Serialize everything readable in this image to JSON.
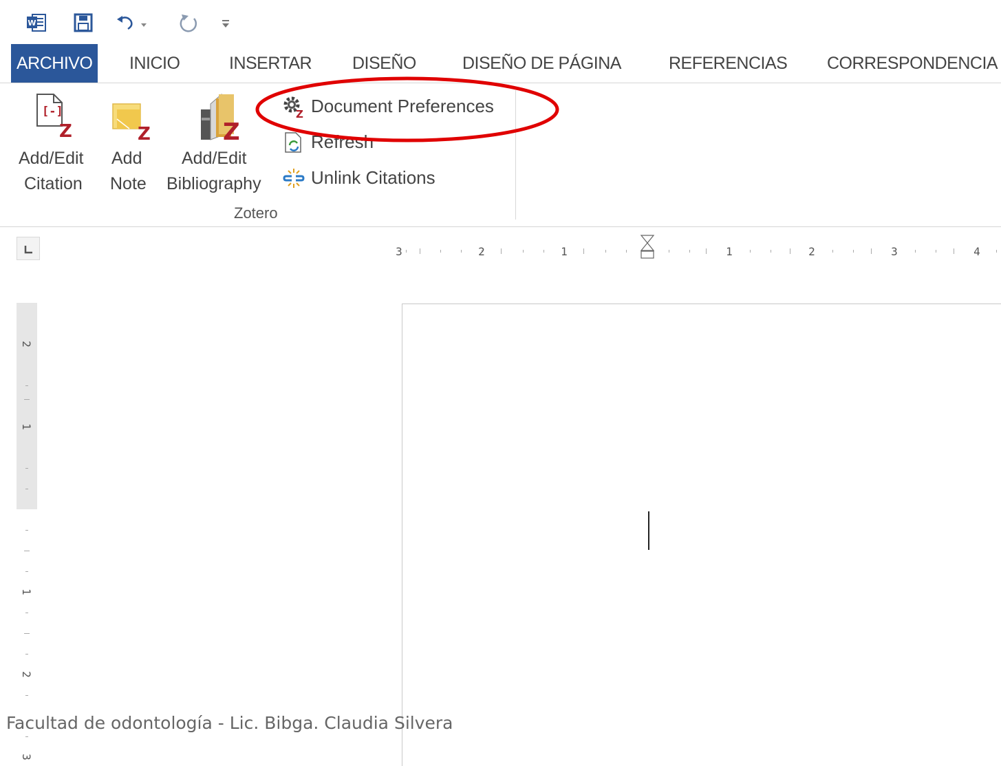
{
  "quick_access": {
    "icons": [
      "word-icon",
      "save-icon",
      "undo-icon",
      "redo-icon",
      "customize-toolbar-icon"
    ]
  },
  "tabs": [
    {
      "label": "ARCHIVO",
      "active": true
    },
    {
      "label": "INICIO"
    },
    {
      "label": "INSERTAR"
    },
    {
      "label": "DISEÑO"
    },
    {
      "label": "DISEÑO DE PÁGINA"
    },
    {
      "label": "REFERENCIAS"
    },
    {
      "label": "CORRESPONDENCIA"
    }
  ],
  "ribbon": {
    "add_edit_citation": {
      "line1": "Add/Edit",
      "line2": "Citation"
    },
    "add_note": {
      "line1": "Add",
      "line2": "Note"
    },
    "add_edit_bibliography": {
      "line1": "Add/Edit",
      "line2": "Bibliography"
    },
    "document_preferences": "Document Preferences",
    "refresh": "Refresh",
    "unlink_citations": "Unlink Citations",
    "group_label": "Zotero"
  },
  "ruler": {
    "horizontal_labels": [
      "3",
      "2",
      "1",
      "1",
      "2",
      "3",
      "4"
    ],
    "vertical_labels": [
      "2",
      "1",
      "1",
      "2",
      "3"
    ]
  },
  "footer": "- Facultad de odontología - Lic. Bibga. Claudia Silvera",
  "colors": {
    "accent": "#2b579a",
    "zotero_red": "#b0202a",
    "annotation": "#e00000"
  }
}
